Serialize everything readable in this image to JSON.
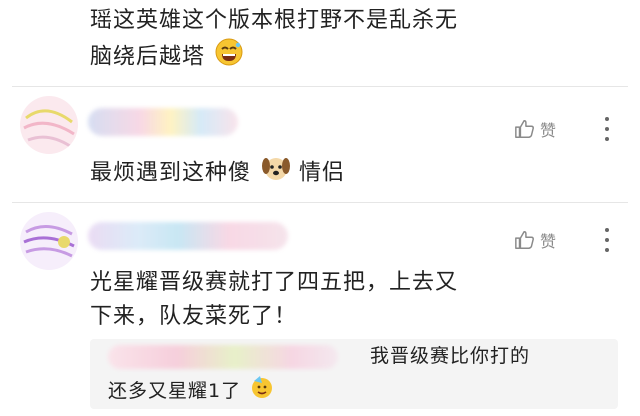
{
  "comments": [
    {
      "text_lines": [
        "瑶这英雄这个版本根打野不是乱杀无",
        "脑绕后越塔"
      ],
      "emoji": "grin-sweat-emoji"
    },
    {
      "text_lines": [
        "最烦遇到这种傻",
        "情侣"
      ],
      "emoji": "dog-face-emoji",
      "like_label": "赞"
    },
    {
      "text_lines": [
        "光星耀晋级赛就打了四五把，上去又",
        "下来，队友菜死了！"
      ],
      "like_label": "赞"
    }
  ],
  "reply": {
    "text_lines": [
      "我晋级赛比你打的",
      "还多又星耀1了"
    ],
    "emoji": "party-face-emoji"
  },
  "icons": {
    "like": "thumbs-up-icon",
    "more": "more-vertical-icon"
  },
  "colors": {
    "text": "#222222",
    "muted": "#8a8a8a",
    "reply_bg": "#f4f4f4"
  }
}
